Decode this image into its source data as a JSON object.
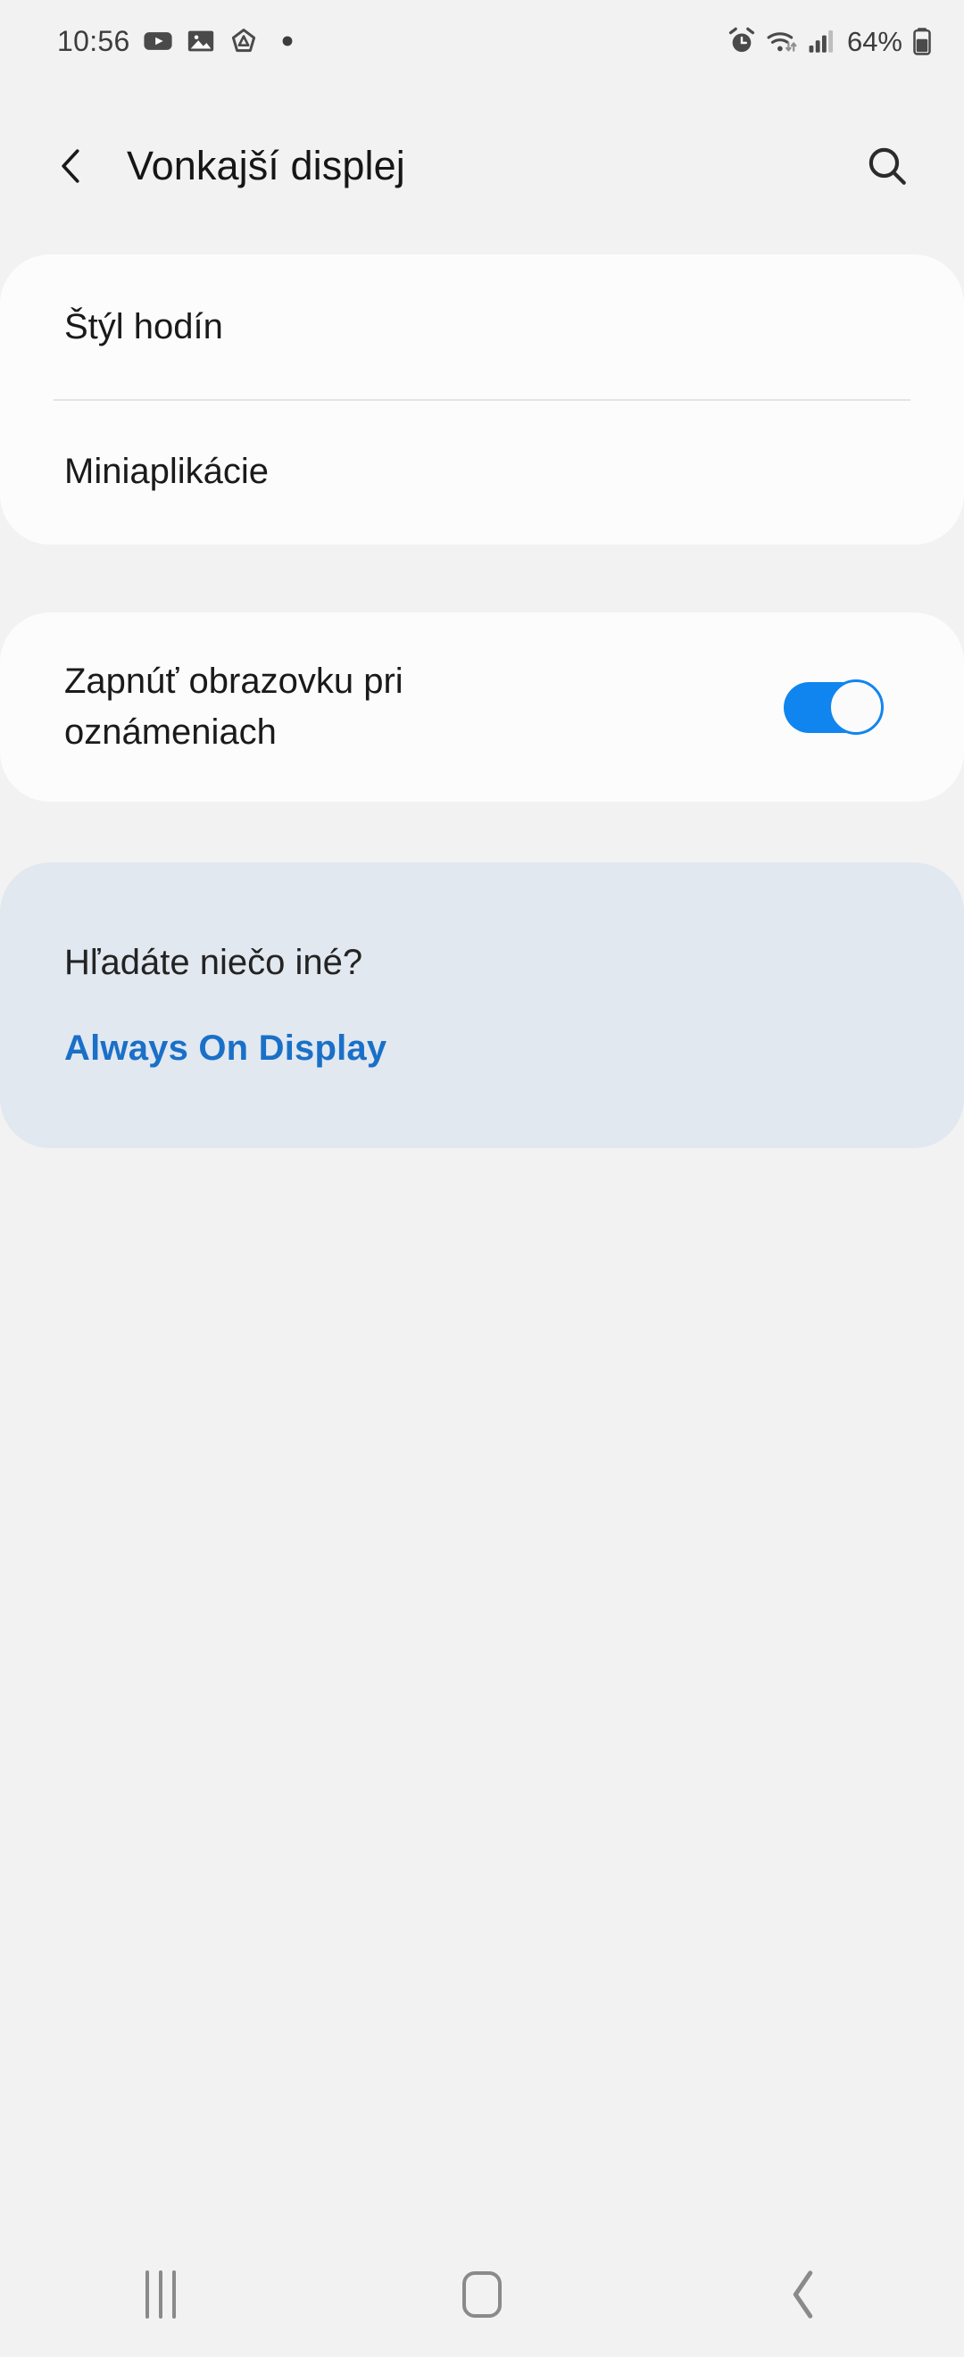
{
  "status_bar": {
    "time": "10:56",
    "left_icons": [
      "youtube-icon",
      "gallery-icon",
      "affinity-icon",
      "dot-icon"
    ],
    "right_icons": [
      "alarm-icon",
      "wifi-icon",
      "signal-icon"
    ],
    "battery_percent": "64%",
    "battery_icon": "battery-icon"
  },
  "app_bar": {
    "back_icon": "back-chevron-icon",
    "title": "Vonkajší displej",
    "search_icon": "search-icon"
  },
  "settings_list": {
    "items": [
      {
        "label": "Štýl hodín"
      },
      {
        "label": "Miniaplikácie"
      }
    ]
  },
  "toggle_setting": {
    "label": "Zapnúť obrazovku pri oznámeniach",
    "enabled": true,
    "accent_color": "#1185ef"
  },
  "info_card": {
    "question": "Hľadáte niečo iné?",
    "link_label": "Always On Display",
    "background_color": "#e2e8f0",
    "link_color": "#1a70c8"
  },
  "nav_bar": {
    "recents_icon": "recents-icon",
    "home_icon": "home-icon",
    "back_icon": "nav-back-icon"
  },
  "theme": {
    "page_background": "#f2f2f2",
    "card_background": "#fcfcfc",
    "text_color": "#1a1a1a"
  }
}
